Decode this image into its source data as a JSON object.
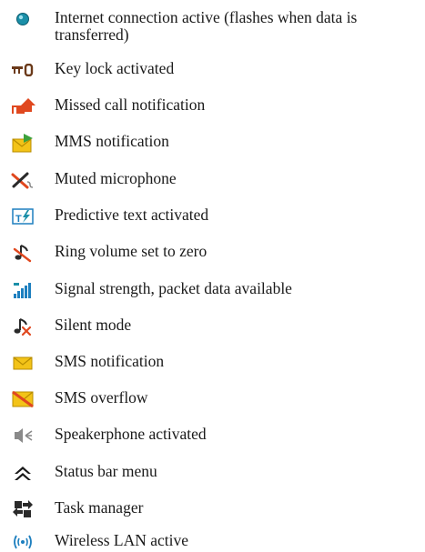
{
  "icon_legend": {
    "items": [
      {
        "icon": "internet-connection-icon",
        "label": "Internet connection active (flashes when data is transferred)"
      },
      {
        "icon": "key-lock-icon",
        "label": "Key lock activated"
      },
      {
        "icon": "missed-call-icon",
        "label": "Missed call notification"
      },
      {
        "icon": "mms-icon",
        "label": "MMS notification"
      },
      {
        "icon": "muted-microphone-icon",
        "label": "Muted microphone"
      },
      {
        "icon": "predictive-text-icon",
        "label": "Predictive text activated"
      },
      {
        "icon": "ring-volume-zero-icon",
        "label": "Ring volume set to zero"
      },
      {
        "icon": "signal-strength-packet-data-icon",
        "label": "Signal strength, packet data available"
      },
      {
        "icon": "silent-mode-icon",
        "label": "Silent mode"
      },
      {
        "icon": "sms-icon",
        "label": "SMS notification"
      },
      {
        "icon": "sms-overflow-icon",
        "label": "SMS overflow"
      },
      {
        "icon": "speakerphone-icon",
        "label": "Speakerphone activated"
      },
      {
        "icon": "status-bar-menu-icon",
        "label": "Status bar menu"
      },
      {
        "icon": "task-manager-icon",
        "label": "Task manager"
      },
      {
        "icon": "wireless-lan-icon",
        "label": "Wireless LAN active"
      }
    ]
  },
  "colors": {
    "text": "#1a1a1a",
    "teal": "#1a8fa8",
    "orange_red": "#e0481f",
    "yellow": "#f3c318",
    "green": "#3ca13c",
    "blue": "#1d7fbf",
    "dark": "#2a2a2a",
    "gray": "#8a8a8a",
    "key_brown": "#6b3a1a"
  }
}
